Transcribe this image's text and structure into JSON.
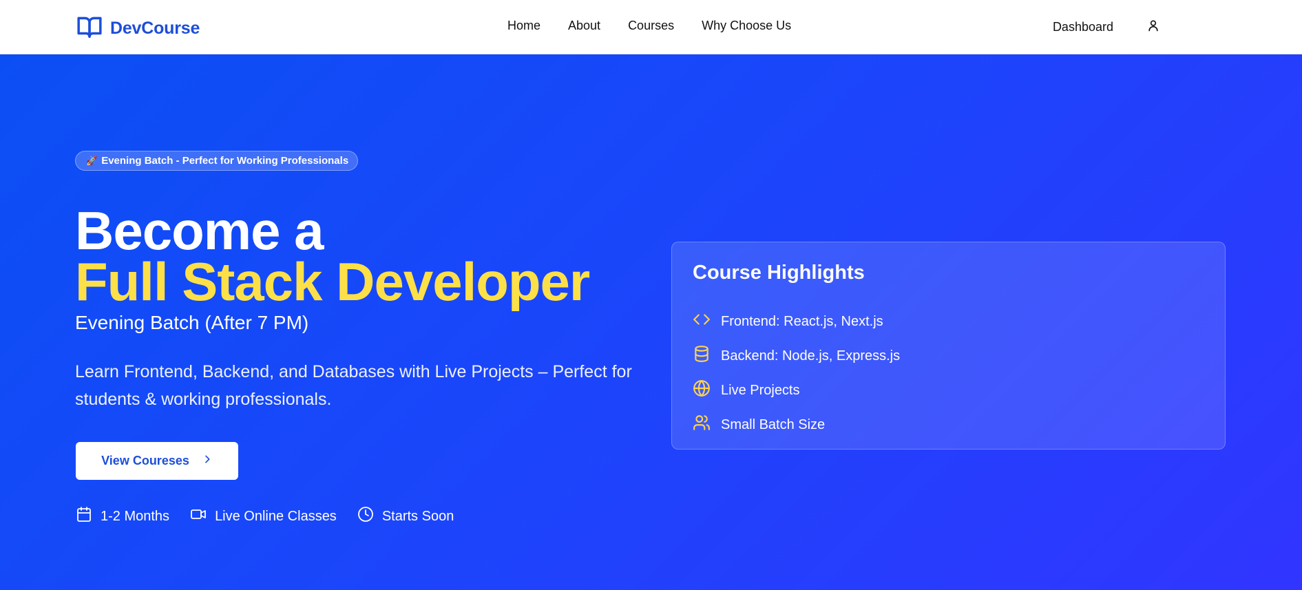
{
  "brand": {
    "name": "DevCourse",
    "icon": "book-open-icon"
  },
  "nav": {
    "links": [
      "Home",
      "About",
      "Courses",
      "Why Choose Us"
    ],
    "dashboard": "Dashboard",
    "user_icon": "user-icon"
  },
  "hero": {
    "badge": {
      "icon": "🚀",
      "text": "Evening Batch - Perfect for Working Professionals"
    },
    "title_line1": "Become a",
    "title_line2": "Full Stack Developer",
    "subtitle": "Evening Batch (After 7 PM)",
    "description": "Learn Frontend, Backend, and Databases with Live Projects – Perfect for students & working professionals.",
    "cta_label": "View Coureses",
    "meta": [
      {
        "icon": "calendar-icon",
        "text": "1-2 Months"
      },
      {
        "icon": "video-icon",
        "text": "Live Online Classes"
      },
      {
        "icon": "clock-icon",
        "text": "Starts Soon"
      }
    ]
  },
  "highlights": {
    "title": "Course Highlights",
    "items": [
      {
        "icon": "code-icon",
        "text": "Frontend: React.js, Next.js"
      },
      {
        "icon": "database-icon",
        "text": "Backend: Node.js, Express.js"
      },
      {
        "icon": "globe-icon",
        "text": "Live Projects"
      },
      {
        "icon": "users-icon",
        "text": "Small Batch Size"
      }
    ]
  },
  "colors": {
    "brand": "#1d4ed8",
    "hero_gradient_start": "#0b4ff4",
    "hero_gradient_end": "#3135ff",
    "accent_yellow": "#fde047",
    "icon_yellow": "#fcd34d"
  }
}
